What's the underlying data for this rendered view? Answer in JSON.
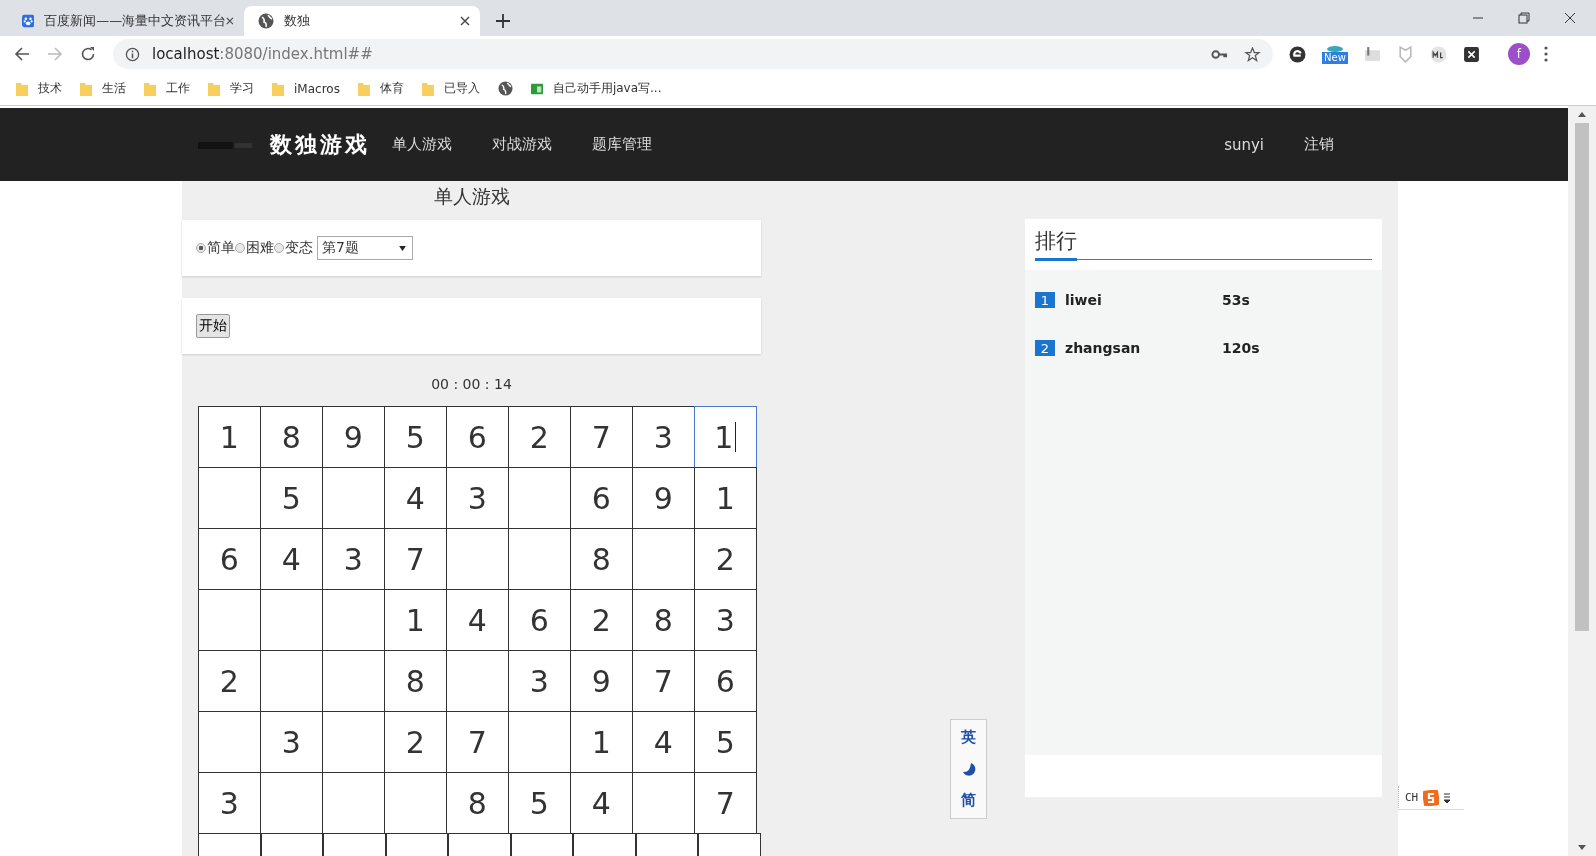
{
  "browser": {
    "tabs": [
      {
        "title": "百度新闻——海量中文资讯平台",
        "selected": false
      },
      {
        "title": "数独",
        "selected": true
      }
    ],
    "address": {
      "host": "localhost",
      "path": ":8080/index.html##"
    },
    "bookmarks": [
      {
        "label": "技术",
        "kind": "folder"
      },
      {
        "label": "生活",
        "kind": "folder"
      },
      {
        "label": "工作",
        "kind": "folder"
      },
      {
        "label": "学习",
        "kind": "folder"
      },
      {
        "label": "iMacros",
        "kind": "folder"
      },
      {
        "label": "体育",
        "kind": "folder"
      },
      {
        "label": "已导入",
        "kind": "folder"
      },
      {
        "kind": "globe"
      },
      {
        "label": "自己动手用java写...",
        "kind": "page"
      }
    ],
    "extension_badge": "New",
    "profile_initial": "f"
  },
  "navbar": {
    "brand": "数独游戏",
    "links": [
      "单人游戏",
      "对战游戏",
      "题库管理"
    ],
    "user": "sunyi",
    "logout": "注销"
  },
  "game": {
    "title": "单人游戏",
    "difficulties": [
      {
        "label": "简单",
        "selected": true
      },
      {
        "label": "困难",
        "selected": false
      },
      {
        "label": "变态",
        "selected": false
      }
    ],
    "puzzle_select": "第7题",
    "start_button": "开始",
    "timer": "00 : 00 : 14",
    "grid": [
      [
        {
          "v": "1",
          "focused": false
        },
        {
          "v": "8",
          "focused": false
        },
        {
          "v": "9",
          "focused": false
        },
        {
          "v": "5",
          "focused": false
        },
        {
          "v": "6",
          "focused": false
        },
        {
          "v": "2",
          "focused": false
        },
        {
          "v": "7",
          "focused": false
        },
        {
          "v": "3",
          "focused": false
        },
        {
          "v": "1",
          "focused": true
        }
      ],
      [
        {
          "focused": false
        },
        {
          "v": "5",
          "focused": false
        },
        {
          "focused": false
        },
        {
          "v": "4",
          "focused": false
        },
        {
          "v": "3",
          "focused": false
        },
        {
          "focused": false
        },
        {
          "v": "6",
          "focused": false
        },
        {
          "v": "9",
          "focused": false
        },
        {
          "v": "1",
          "focused": false
        }
      ],
      [
        {
          "v": "6",
          "focused": false
        },
        {
          "v": "4",
          "focused": false
        },
        {
          "v": "3",
          "focused": false
        },
        {
          "v": "7",
          "focused": false
        },
        {
          "focused": false
        },
        {
          "focused": false
        },
        {
          "v": "8",
          "focused": false
        },
        {
          "focused": false
        },
        {
          "v": "2",
          "focused": false
        }
      ],
      [
        {
          "focused": false
        },
        {
          "focused": false
        },
        {
          "focused": false
        },
        {
          "v": "1",
          "focused": false
        },
        {
          "v": "4",
          "focused": false
        },
        {
          "v": "6",
          "focused": false
        },
        {
          "v": "2",
          "focused": false
        },
        {
          "v": "8",
          "focused": false
        },
        {
          "v": "3",
          "focused": false
        }
      ],
      [
        {
          "v": "2",
          "focused": false
        },
        {
          "focused": false
        },
        {
          "focused": false
        },
        {
          "v": "8",
          "focused": false
        },
        {
          "focused": false
        },
        {
          "v": "3",
          "focused": false
        },
        {
          "v": "9",
          "focused": false
        },
        {
          "v": "7",
          "focused": false
        },
        {
          "v": "6",
          "focused": false
        }
      ],
      [
        {
          "focused": false
        },
        {
          "v": "3",
          "focused": false
        },
        {
          "focused": false
        },
        {
          "v": "2",
          "focused": false
        },
        {
          "v": "7",
          "focused": false
        },
        {
          "focused": false
        },
        {
          "v": "1",
          "focused": false
        },
        {
          "v": "4",
          "focused": false
        },
        {
          "v": "5",
          "focused": false
        }
      ],
      [
        {
          "v": "3",
          "focused": false
        },
        {
          "focused": false
        },
        {
          "focused": false
        },
        {
          "focused": false
        },
        {
          "v": "8",
          "focused": false
        },
        {
          "v": "5",
          "focused": false
        },
        {
          "v": "4",
          "focused": false
        },
        {
          "focused": false
        },
        {
          "v": "7",
          "focused": false
        }
      ]
    ]
  },
  "ranking": {
    "title": "排行",
    "entries": [
      {
        "rank": "1",
        "name": "liwei",
        "time": "53s"
      },
      {
        "rank": "2",
        "name": "zhangsan",
        "time": "120s"
      }
    ]
  },
  "ime_toolbar": {
    "top": "英",
    "bottom": "简"
  },
  "ime_indicator": "CH"
}
